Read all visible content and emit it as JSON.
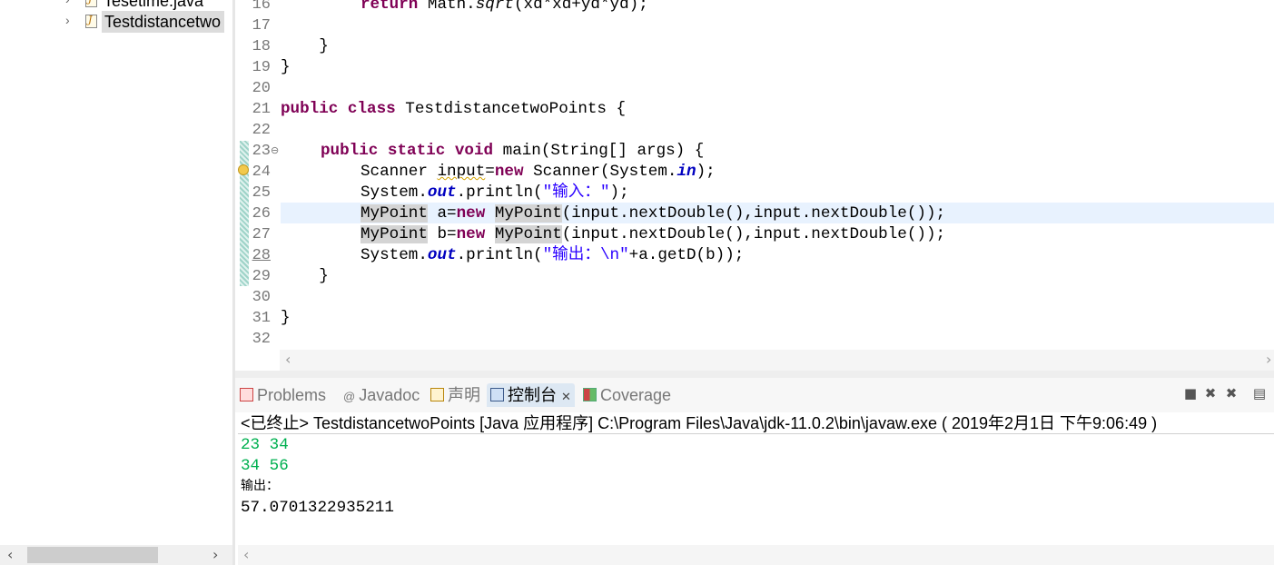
{
  "explorer": {
    "items": [
      {
        "label": "Tesetime.java",
        "selected": false
      },
      {
        "label": "Testdistancetwo",
        "selected": true
      }
    ]
  },
  "editor": {
    "line_numbers": [
      "16",
      "17",
      "18",
      "19",
      "20",
      "21",
      "22",
      "23",
      "24",
      "25",
      "26",
      "27",
      "28",
      "29",
      "30",
      "31",
      "32"
    ],
    "code": {
      "l16_kw": "return",
      "l16_rest_a": " Math.",
      "l16_sqrt": "sqrt",
      "l16_rest_b": "(xd*xd+yd*yd);",
      "l18": "    }",
      "l19": "}",
      "l21_kw1": "public",
      "l21_kw2": "class",
      "l21_rest": " TestdistancetwoPoints {",
      "l23_kw1": "public",
      "l23_kw2": "static",
      "l23_kw3": "void",
      "l23_rest": " main(String[] args) {",
      "l24_a": "Scanner ",
      "l24_var": "input",
      "l24_eq": "=",
      "l24_new": "new",
      "l24_b": " Scanner(System.",
      "l24_in": "in",
      "l24_c": ");",
      "l25_a": "System.",
      "l25_out": "out",
      "l25_b": ".println(",
      "l25_str": "\"输入：\"",
      "l25_c": ");",
      "l26_t1": "MyPoint",
      "l26_a": " a=",
      "l26_new": "new",
      "l26_sp": " ",
      "l26_t2": "MyPoint",
      "l26_b": "(input.nextDouble(),input.nextDouble());",
      "l27_t1": "MyPoint",
      "l27_a": " b=",
      "l27_new": "new",
      "l27_sp": " ",
      "l27_t2": "MyPoint",
      "l27_b": "(input.nextDouble(),input.nextDouble());",
      "l28_a": "System.",
      "l28_out": "out",
      "l28_b": ".println(",
      "l28_str": "\"输出：\\n\"",
      "l28_c": "+a.getD(b));",
      "l29": "    }",
      "l31": "}"
    }
  },
  "console": {
    "tabs": [
      {
        "label": "Problems"
      },
      {
        "label": "Javadoc"
      },
      {
        "label": "声明"
      },
      {
        "label": "控制台"
      },
      {
        "label": "Coverage"
      }
    ],
    "header": "<已终止> TestdistancetwoPoints [Java 应用程序] C:\\Program Files\\Java\\jdk-11.0.2\\bin\\javaw.exe ( 2019年2月1日 下午9:06:49 )",
    "output": [
      {
        "text": "23 34",
        "kind": "input"
      },
      {
        "text": "34 56",
        "kind": "input"
      },
      {
        "text": "输出：",
        "kind": "stdout"
      },
      {
        "text": "57.0701322935211",
        "kind": "stdout"
      }
    ]
  },
  "colors": {
    "keyword": "#7f0055",
    "field": "#0000c0",
    "string": "#2a00ff",
    "console_input": "#00b050",
    "current_line": "#e8f2fe"
  }
}
